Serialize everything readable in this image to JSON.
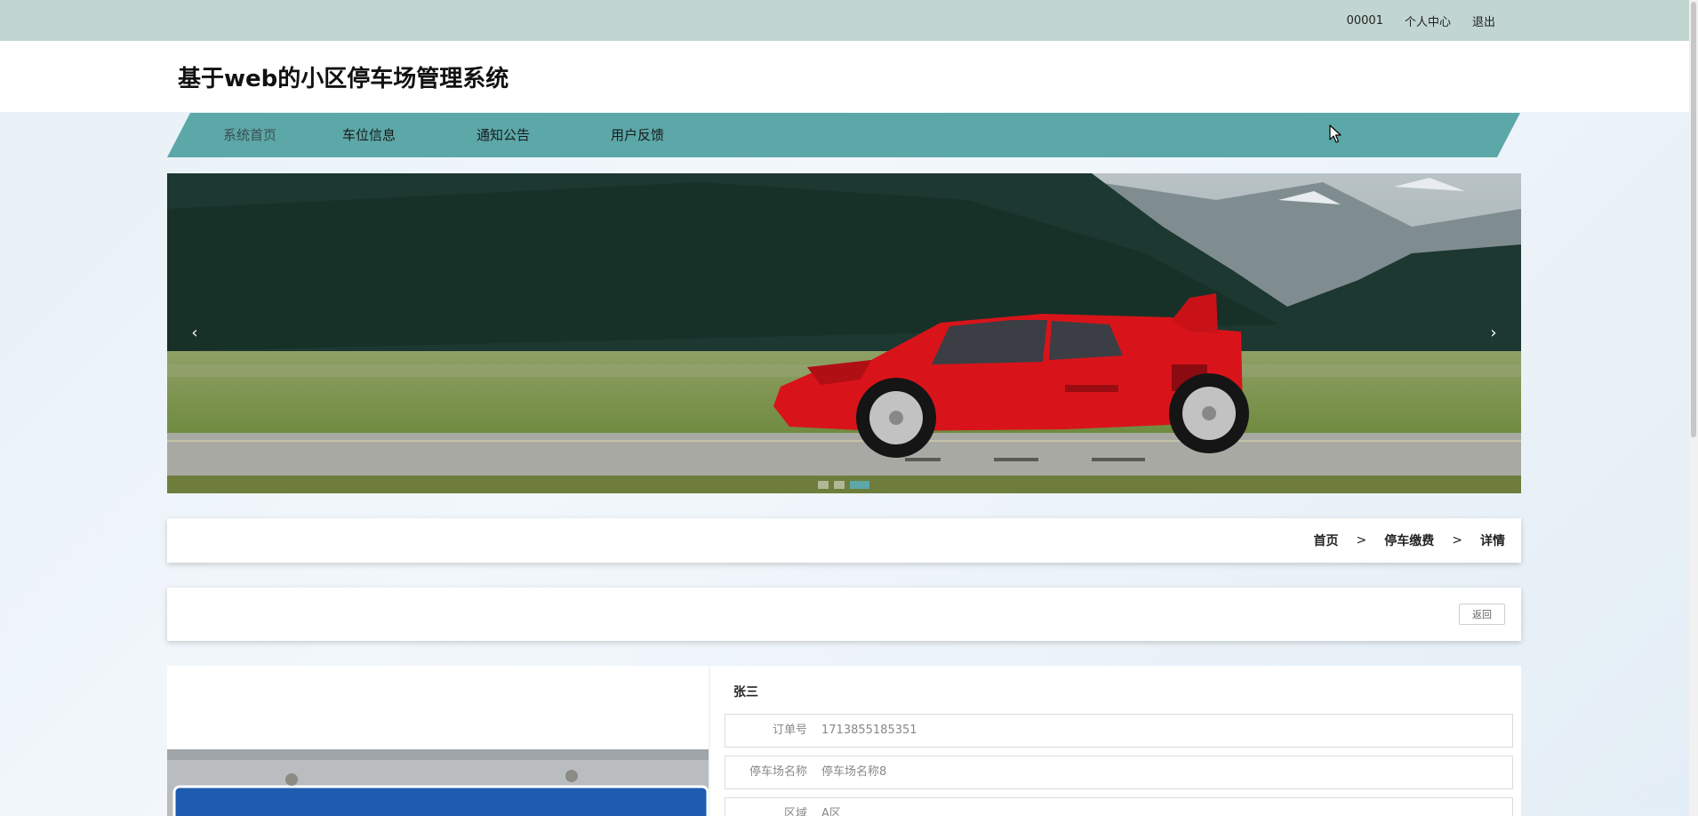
{
  "topbar": {
    "username": "00001",
    "personal_center": "个人中心",
    "logout": "退出"
  },
  "header": {
    "title": "基于web的小区停车场管理系统"
  },
  "nav": {
    "items": [
      {
        "label": "系统首页",
        "active": true
      },
      {
        "label": "车位信息",
        "active": false
      },
      {
        "label": "通知公告",
        "active": false
      },
      {
        "label": "用户反馈",
        "active": false
      }
    ]
  },
  "banner": {
    "prev": "‹",
    "next": "›",
    "slide_count": 3,
    "active_slide": 3
  },
  "breadcrumb": {
    "home": "首页",
    "section": "停车缴费",
    "current": "详情",
    "separator": ">"
  },
  "actions": {
    "back_label": "返回"
  },
  "detail": {
    "owner_name": "张三",
    "fields": [
      {
        "label": "订单号",
        "value": "1713855185351"
      },
      {
        "label": "停车场名称",
        "value": "停车场名称8"
      },
      {
        "label": "区域",
        "value": "A区"
      }
    ]
  },
  "colors": {
    "topbar": "#c1d6d1",
    "nav": "#5ca7a8",
    "accent": "#5ca7a8"
  },
  "icons": {
    "cursor": "mouse-pointer-icon",
    "prev": "chevron-left-icon",
    "next": "chevron-right-icon"
  }
}
